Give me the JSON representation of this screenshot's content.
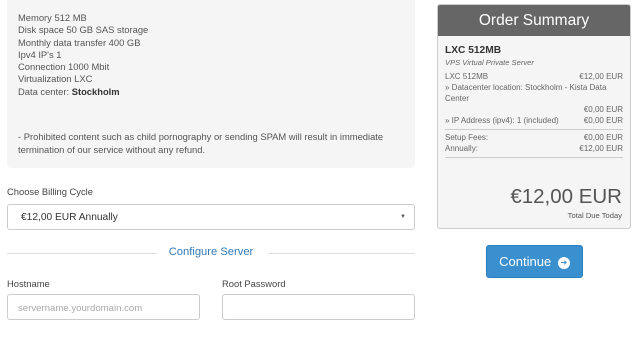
{
  "product_details": {
    "specs": [
      {
        "text": "Memory 512 MB"
      },
      {
        "text": "Disk space 50 GB SAS storage"
      },
      {
        "text": "Monthly data transfer 400 GB"
      },
      {
        "text": "Ipv4 IP's 1"
      },
      {
        "text": "Connection 1000 Mbit"
      },
      {
        "text": "Virtualization LXC"
      }
    ],
    "datacenter_label": "Data center: ",
    "datacenter_value": "Stockholm",
    "note": "- Prohibited content such as child pornography or sending SPAM will result in immediate termination of our service without any refund."
  },
  "billing": {
    "label": "Choose Billing Cycle",
    "selected": "€12,00 EUR Annually"
  },
  "configure": {
    "title": "Configure Server",
    "hostname_label": "Hostname",
    "hostname_placeholder": "servername.yourdomain.com",
    "root_password_label": "Root Password",
    "root_password_value": ""
  },
  "order_summary": {
    "title": "Order Summary",
    "product_name": "LXC 512MB",
    "product_group": "VPS Virtual Private Server",
    "lines": [
      {
        "label": "LXC 512MB",
        "value": "€12,00 EUR"
      },
      {
        "label": "» Datacenter location: Stockholm - Kista Data Center",
        "value": "€0,00 EUR"
      },
      {
        "label": "» IP Address (ipv4): 1 (included)",
        "value": "€0,00 EUR"
      }
    ],
    "setup_fees_label": "Setup Fees:",
    "setup_fees_value": "€0,00 EUR",
    "annually_label": "Annually:",
    "annually_value": "€12,00 EUR",
    "total": "€12,00 EUR",
    "total_caption": "Total Due Today"
  },
  "continue_button": {
    "label": "Continue",
    "icon": "arrow-circle-right-icon"
  }
}
